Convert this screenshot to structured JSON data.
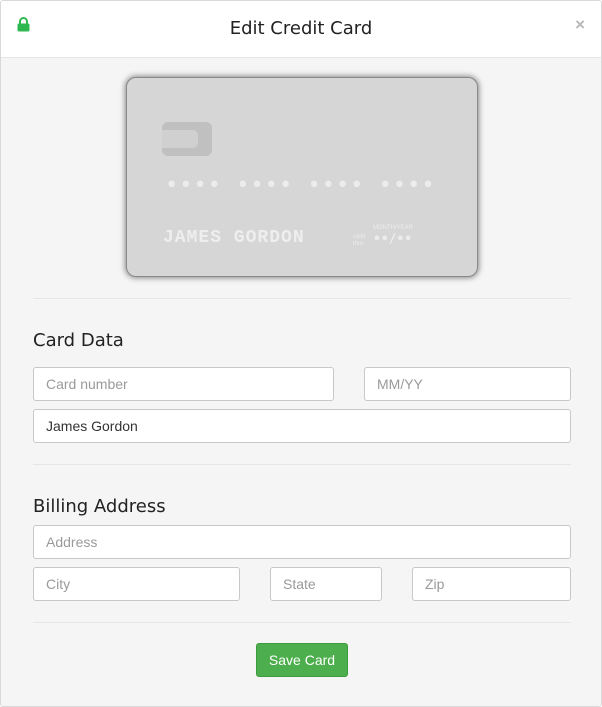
{
  "modal": {
    "title": "Edit Credit Card",
    "close_label": "×",
    "lock_icon": "lock-icon",
    "accent_color": "#4cae4c"
  },
  "card": {
    "number": "•••• •••• •••• ••••",
    "holder": "JAMES GORDON",
    "valid_label": "valid thru",
    "expiry_label": "MONTH/YEAR",
    "expiry": "••/••"
  },
  "card_data": {
    "heading": "Card Data",
    "number_placeholder": "Card number",
    "expiry_placeholder": "MM/YY",
    "name_value": "James Gordon"
  },
  "billing": {
    "heading": "Billing Address",
    "address_placeholder": "Address",
    "city_placeholder": "City",
    "state_placeholder": "State",
    "zip_placeholder": "Zip"
  },
  "footer": {
    "save_label": "Save Card"
  }
}
